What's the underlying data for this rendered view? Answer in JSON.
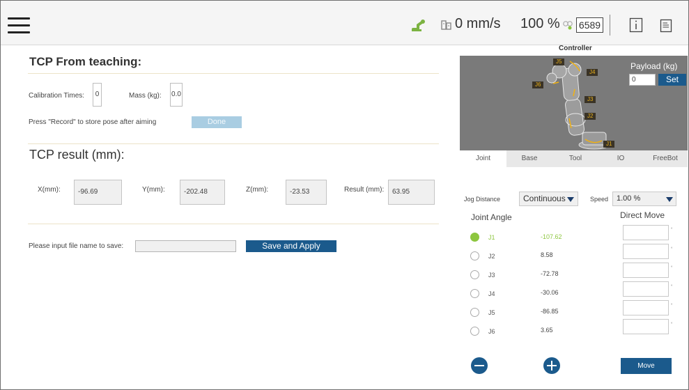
{
  "topbar": {
    "speed": "0 mm/s",
    "percent": "100 %",
    "counter": "6589",
    "icons": [
      "menu-icon",
      "robot-arm-status-icon",
      "speed-gauge-icon",
      "link-status-icon",
      "info-icon",
      "log-icon"
    ]
  },
  "teaching": {
    "title": "TCP From teaching:",
    "calibration_label": "Calibration Times:",
    "calibration_value": "0",
    "mass_label": "Mass (kg):",
    "mass_value": "0.0",
    "record_hint": "Press \"Record\" to store pose after aiming",
    "done_label": "Done"
  },
  "result": {
    "title": "TCP result (mm):",
    "x_label": "X(mm):",
    "x_value": "-96.69",
    "y_label": "Y(mm):",
    "y_value": "-202.48",
    "z_label": "Z(mm):",
    "z_value": "-23.53",
    "r_label": "Result (mm):",
    "r_value": "63.95"
  },
  "save": {
    "prompt": "Please input file name to save:",
    "filename": "",
    "button": "Save and Apply"
  },
  "controller": {
    "title": "Controller",
    "joint_tags": [
      "J5",
      "J4",
      "J6",
      "J3",
      "J2",
      "J1"
    ],
    "payload_label": "Payload (kg)",
    "payload_value": "0",
    "set_label": "Set",
    "tabs": [
      "Joint",
      "Base",
      "Tool",
      "IO",
      "FreeBot"
    ],
    "active_tab": "Joint"
  },
  "jog": {
    "distance_label": "Jog Distance",
    "distance_value": "Continuous",
    "speed_label": "Speed",
    "speed_value": "1.00 %"
  },
  "joints": {
    "angle_title": "Joint Angle",
    "direct_title": "Direct Move",
    "degree_symbol": "°",
    "rows": [
      {
        "name": "J1",
        "value": "-107.62",
        "selected": true
      },
      {
        "name": "J2",
        "value": "8.58",
        "selected": false
      },
      {
        "name": "J3",
        "value": "-72.78",
        "selected": false
      },
      {
        "name": "J4",
        "value": "-30.06",
        "selected": false
      },
      {
        "name": "J5",
        "value": "-86.85",
        "selected": false
      },
      {
        "name": "J6",
        "value": "3.65",
        "selected": false
      }
    ],
    "move_label": "Move"
  },
  "colors": {
    "accent": "#1b5a8c",
    "selected": "#8dc63f",
    "done_disabled": "#a9cde2",
    "joint_tag": "#e8b01c"
  }
}
